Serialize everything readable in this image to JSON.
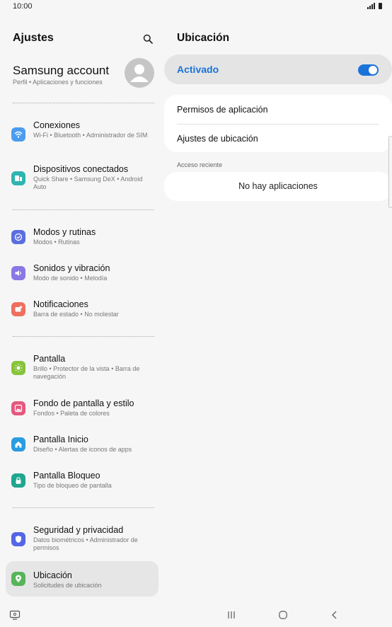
{
  "status_bar": {
    "time": "10:00",
    "icons": [
      "signal-icon",
      "battery-icon"
    ]
  },
  "left": {
    "title": "Ajustes",
    "account": {
      "name": "Samsung account",
      "subtitle": "Perfil  •  Aplicaciones y funciones"
    },
    "items": [
      {
        "title": "Conexiones",
        "subtitle": "Wi-Fi  •  Bluetooth  •  Administrador de SIM",
        "icon": "wifi-icon",
        "color": "#4a9cf0"
      },
      {
        "title": "Dispositivos conectados",
        "subtitle": "Quick Share  •  Samsung DeX  •  Android Auto",
        "icon": "devices-icon",
        "color": "#2fb5b1"
      },
      {
        "title": "Modos y rutinas",
        "subtitle": "Modos  •  Rutinas",
        "icon": "routines-icon",
        "color": "#5b6ee0"
      },
      {
        "title": "Sonidos y vibración",
        "subtitle": "Modo de sonido  •  Melodía",
        "icon": "sound-icon",
        "color": "#8a78e6"
      },
      {
        "title": "Notificaciones",
        "subtitle": "Barra de estado  •  No molestar",
        "icon": "notifications-icon",
        "color": "#ef6f5e"
      },
      {
        "title": "Pantalla",
        "subtitle": "Brillo  •  Protector de la vista  •  Barra de navegación",
        "icon": "display-icon",
        "color": "#86c43a"
      },
      {
        "title": "Fondo de pantalla y estilo",
        "subtitle": "Fondos  •  Paleta de colores",
        "icon": "wallpaper-icon",
        "color": "#e5587e"
      },
      {
        "title": "Pantalla Inicio",
        "subtitle": "Diseño  •  Alertas de iconos de apps",
        "icon": "home-icon",
        "color": "#2a9ce0"
      },
      {
        "title": "Pantalla Bloqueo",
        "subtitle": "Tipo de bloqueo de pantalla",
        "icon": "lock-icon",
        "color": "#1fa68f"
      },
      {
        "title": "Seguridad y privacidad",
        "subtitle": "Datos biométricos  •  Administrador de permisos",
        "icon": "shield-icon",
        "color": "#5566e6"
      },
      {
        "title": "Ubicación",
        "subtitle": "Solicitudes de ubicación",
        "icon": "location-icon",
        "color": "#57b55a"
      }
    ]
  },
  "right": {
    "title": "Ubicación",
    "switch_label": "Activado",
    "switch_on": true,
    "accent": "#1a73d9",
    "options": [
      "Permisos de aplicación",
      "Ajustes de ubicación"
    ],
    "recent_label": "Acceso reciente",
    "empty_text": "No hay aplicaciones"
  },
  "nav": {
    "buttons": [
      "recents-icon",
      "home-button-icon",
      "back-icon"
    ],
    "left_icon": "screen-mode-icon"
  }
}
